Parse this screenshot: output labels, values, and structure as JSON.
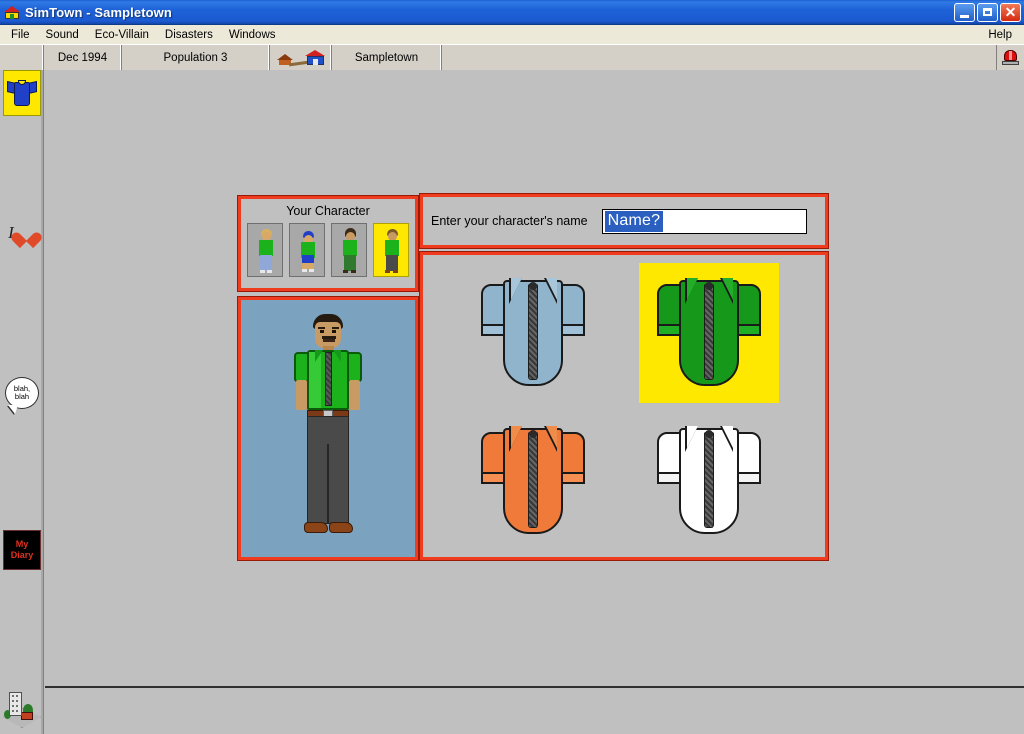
{
  "window": {
    "title": "SimTown - Sampletown",
    "app_icon": "house-icon",
    "buttons": {
      "minimize": "minimize-icon",
      "maximize": "restore-icon",
      "close": "close-icon"
    }
  },
  "menu": {
    "items": [
      "File",
      "Sound",
      "Eco-Villain",
      "Disasters",
      "Windows"
    ],
    "help": "Help"
  },
  "toolstrip": {
    "date": "Dec 1994",
    "population": "Population 3",
    "move_icon": "two-houses-icon",
    "town": "Sampletown",
    "alarm_icon": "alarm-siren-icon"
  },
  "sidebar": {
    "items": [
      {
        "name": "tshirt",
        "icon": "tshirt-icon",
        "selected": true
      },
      {
        "name": "love",
        "icon": "i-heart-icon",
        "label": "I",
        "selected": false
      },
      {
        "name": "talk",
        "icon": "speech-bubble-icon",
        "line1": "blah,",
        "line2": "blah",
        "selected": false
      },
      {
        "name": "diary",
        "icon": "diary-book-icon",
        "line1": "My",
        "line2": "Diary",
        "selected": false
      }
    ],
    "bottom_icon": "city-building-icon"
  },
  "character_panel": {
    "title": "Your Character",
    "thumbnails": [
      {
        "name": "blonde-woman-jeans",
        "selected": false,
        "hair": "#d8b060",
        "shirt": "#1cb21c",
        "legs": "#8fa8d8"
      },
      {
        "name": "kid-blue-cap",
        "selected": false,
        "hair": "#2040c8",
        "shirt": "#1cb21c",
        "legs": "#2040c8"
      },
      {
        "name": "woman-green-outfit",
        "selected": false,
        "hair": "#3a2a18",
        "shirt": "#1cb21c",
        "legs": "#2f7a2f"
      },
      {
        "name": "man-green-shirt",
        "selected": true,
        "hair": "#b08040",
        "shirt": "#1cb21c",
        "legs": "#4a4a4a"
      }
    ]
  },
  "preview": {
    "background_color": "#7ba3bf",
    "shirt_color": "#1cb21c",
    "pants_color": "#4a4a4a",
    "shoe_color": "#8a4418",
    "skin_color": "#c89a64",
    "hair_color": "#241a10"
  },
  "name_form": {
    "label": "Enter your character's name",
    "value": "Name?",
    "placeholder": "Name?",
    "selected": true,
    "selection_color": "#2a5fc0"
  },
  "shirt_picker": {
    "selection_color": "#ffe800",
    "options": [
      {
        "name": "shirt-light-blue",
        "color": "#8fb4cc",
        "label": "Light Blue",
        "selected": false
      },
      {
        "name": "shirt-green",
        "color": "#16991b",
        "label": "Green",
        "selected": true
      },
      {
        "name": "shirt-orange",
        "color": "#ef7a3a",
        "label": "Orange",
        "selected": false
      },
      {
        "name": "shirt-white",
        "color": "#ffffff",
        "label": "White",
        "selected": false
      }
    ]
  }
}
